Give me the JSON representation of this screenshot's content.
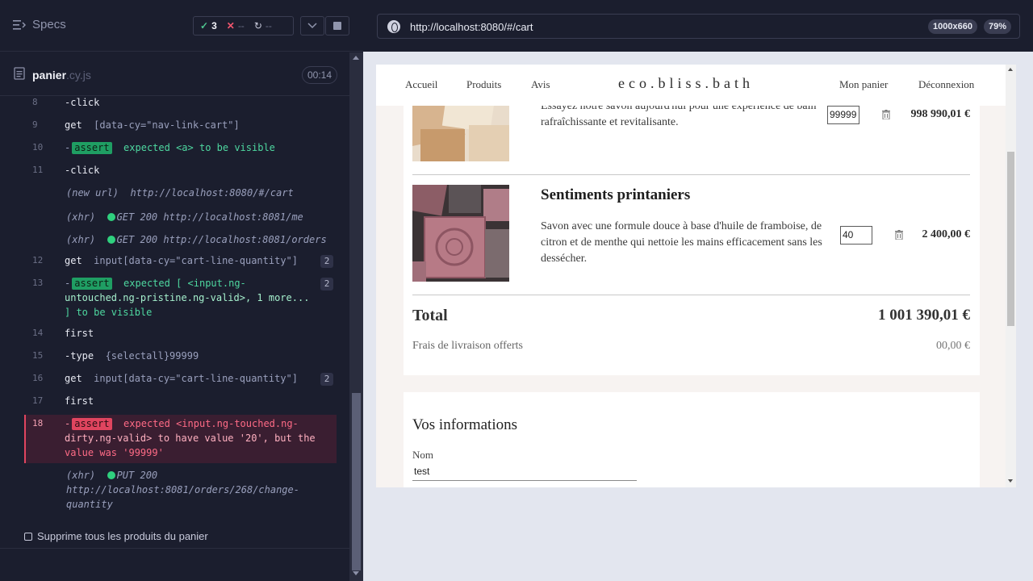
{
  "reporter": {
    "specs_label": "Specs",
    "stats": {
      "passed": "3",
      "failed": "--",
      "pending": "--"
    },
    "spec": {
      "name": "panier",
      "ext": ".cy.js",
      "duration": "00:14"
    },
    "commands": [
      {
        "num": "8",
        "name": "-click"
      },
      {
        "num": "9",
        "name": "get",
        "message": "[data-cy=\"nav-link-cart\"]"
      },
      {
        "num": "10",
        "badge": "assert",
        "message": "expected <a> to be visible"
      },
      {
        "num": "11",
        "name": "-click"
      },
      {
        "kind": "(new url)",
        "message": "http://localhost:8080/#/cart"
      },
      {
        "kind": "(xhr)",
        "message": "GET 200 http://localhost:8081/me"
      },
      {
        "kind": "(xhr)",
        "message": "GET 200 http://localhost:8081/orders"
      },
      {
        "num": "12",
        "name": "get",
        "message": "input[data-cy=\"cart-line-quantity\"]",
        "count": "2"
      },
      {
        "num": "13",
        "badge": "assert",
        "message_line1": "expected [ <input.ng-",
        "message_line2": "untouched.ng-pristine.ng-valid>, 1 more...",
        "message_line3": "] to be visible",
        "count": "2"
      },
      {
        "num": "14",
        "name": "first"
      },
      {
        "num": "15",
        "name": "-type",
        "message": "{selectall}99999"
      },
      {
        "num": "16",
        "name": "get",
        "message": "input[data-cy=\"cart-line-quantity\"]",
        "count": "2"
      },
      {
        "num": "17",
        "name": "first"
      },
      {
        "num": "18",
        "badge": "assert",
        "message_line1": "expected <input.ng-touched.ng-",
        "message_line2": "dirty.ng-valid> to have value '20', but the",
        "message_line3": "value was '99999'"
      },
      {
        "kind": "(xhr)",
        "message_line1": "PUT 200",
        "message_line2": "http://localhost:8081/orders/268/change-",
        "message_line3": "quantity"
      }
    ],
    "suite_title": "Supprime tous les produits du panier"
  },
  "aut": {
    "url": "http://localhost:8080/#/cart",
    "viewport": "1000x660",
    "zoom": "79%",
    "nav": {
      "home": "Accueil",
      "products": "Produits",
      "reviews": "Avis",
      "logo": "eco.bliss.bath",
      "cart": "Mon panier",
      "logout": "Déconnexion"
    },
    "cart": {
      "items": [
        {
          "desc": "Essayez notre savon aujourd'hui pour une expérience de bain rafraîchissante et revitalisante.",
          "quantity": "99999",
          "price": "998 990,01 €"
        },
        {
          "title": "Sentiments printaniers",
          "desc": "Savon avec une formule douce à base d'huile de framboise, de citron et de menthe qui nettoie les mains efficacement sans les dessécher.",
          "quantity": "40",
          "price": "2 400,00 €"
        }
      ],
      "total_label": "Total",
      "total_value": "1 001 390,01 €",
      "shipping_label": "Frais de livraison offerts",
      "shipping_value": "00,00 €"
    },
    "info": {
      "title": "Vos informations",
      "name_label": "Nom",
      "name_value": "test"
    }
  }
}
